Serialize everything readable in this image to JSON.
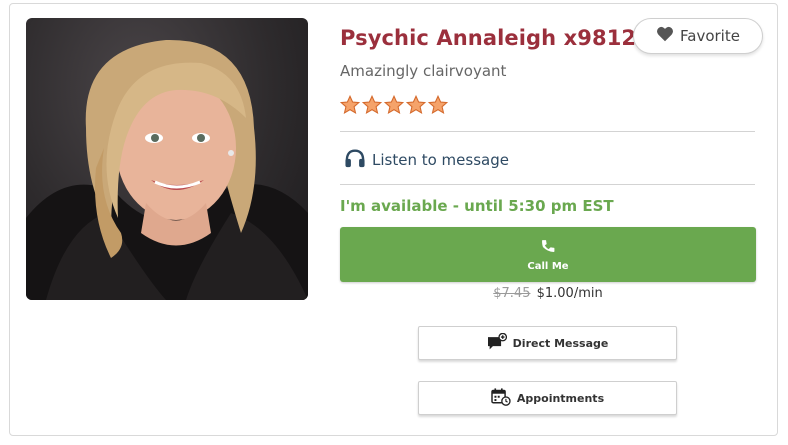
{
  "profile": {
    "name": "Psychic Annaleigh x9812",
    "tagline": "Amazingly clairvoyant",
    "rating_stars": 5,
    "photo_alt": "Psychic Annaleigh photo"
  },
  "favorite": {
    "label": "Favorite",
    "icon": "heart-icon"
  },
  "listen": {
    "label": "Listen to message",
    "icon": "headphones-icon"
  },
  "availability": {
    "text": "I'm available - until 5:30 pm EST"
  },
  "call": {
    "label": "Call Me",
    "icon": "phone-icon"
  },
  "price": {
    "old": "$7.45",
    "current": "$1.00/min"
  },
  "actions": {
    "direct_message": {
      "label": "Direct Message",
      "icon": "message-icon"
    },
    "appointments": {
      "label": "Appointments",
      "icon": "calendar-icon"
    }
  },
  "colors": {
    "name": "#9b2f3c",
    "accent_green": "#6aa84f",
    "star": "#f08a4b",
    "link": "#2e4a63"
  }
}
